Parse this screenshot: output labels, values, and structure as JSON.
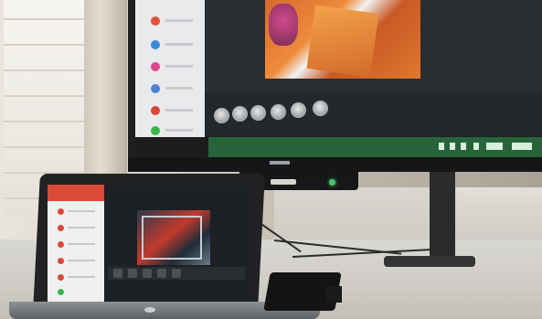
{
  "scene": {
    "description_free": true,
    "monitor": {
      "has_video_call": true,
      "taskbar_color": "#27643a",
      "brand_visible": true
    },
    "laptop": {
      "has_video_call": true,
      "sidebar_accent": "#d94a38"
    },
    "colors": {
      "monitor_video_orange": "#ef8b3a",
      "monitor_led_green": "#49c46b",
      "desk": "#cfccc6"
    },
    "icons": [
      "participant-avatar-icon",
      "tray-icon"
    ]
  }
}
